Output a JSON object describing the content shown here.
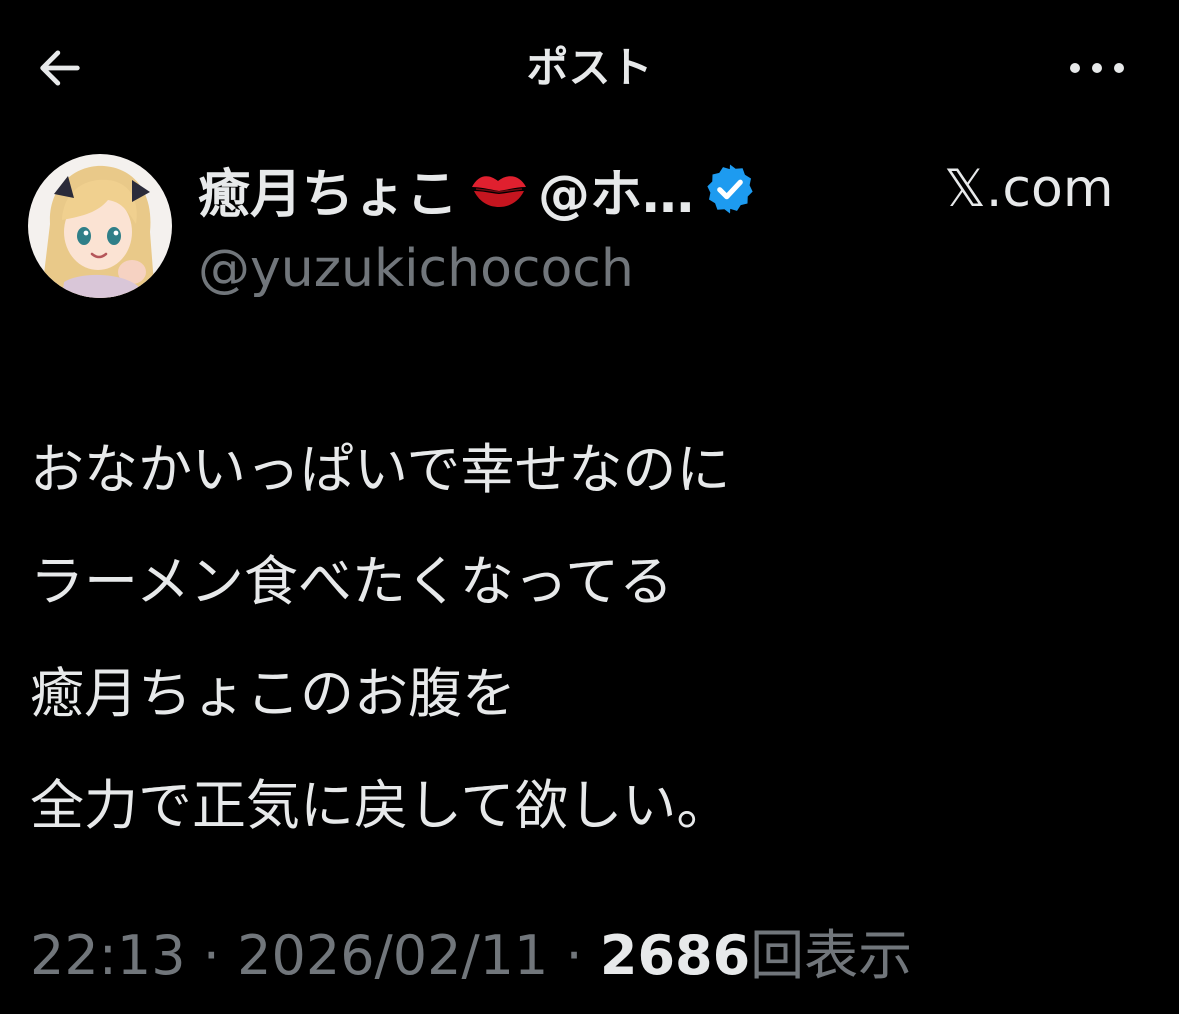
{
  "header": {
    "title": "ポスト",
    "back_icon": "arrow-left-icon",
    "more_icon": "more-horizontal-icon"
  },
  "author": {
    "display_name": "癒月ちょこ",
    "emoji": "kiss-mark-icon",
    "display_name_tail": "@ホ…",
    "verified": true,
    "verified_color": "#1d9bf0",
    "handle": "@yuzukichococh",
    "source": "𝕏.com"
  },
  "post": {
    "lines": [
      "おなかいっぱいで幸せなのに",
      "ラーメン食べたくなってる",
      "癒月ちょこのお腹を",
      "全力で正気に戻して欲しい。"
    ]
  },
  "meta": {
    "time": "22:13",
    "separator": " · ",
    "date": "2026/02/11",
    "views_count": "2686",
    "views_label": "回表示"
  },
  "colors": {
    "background": "#000000",
    "text_primary": "#e7e9ea",
    "text_secondary": "#71767b"
  }
}
